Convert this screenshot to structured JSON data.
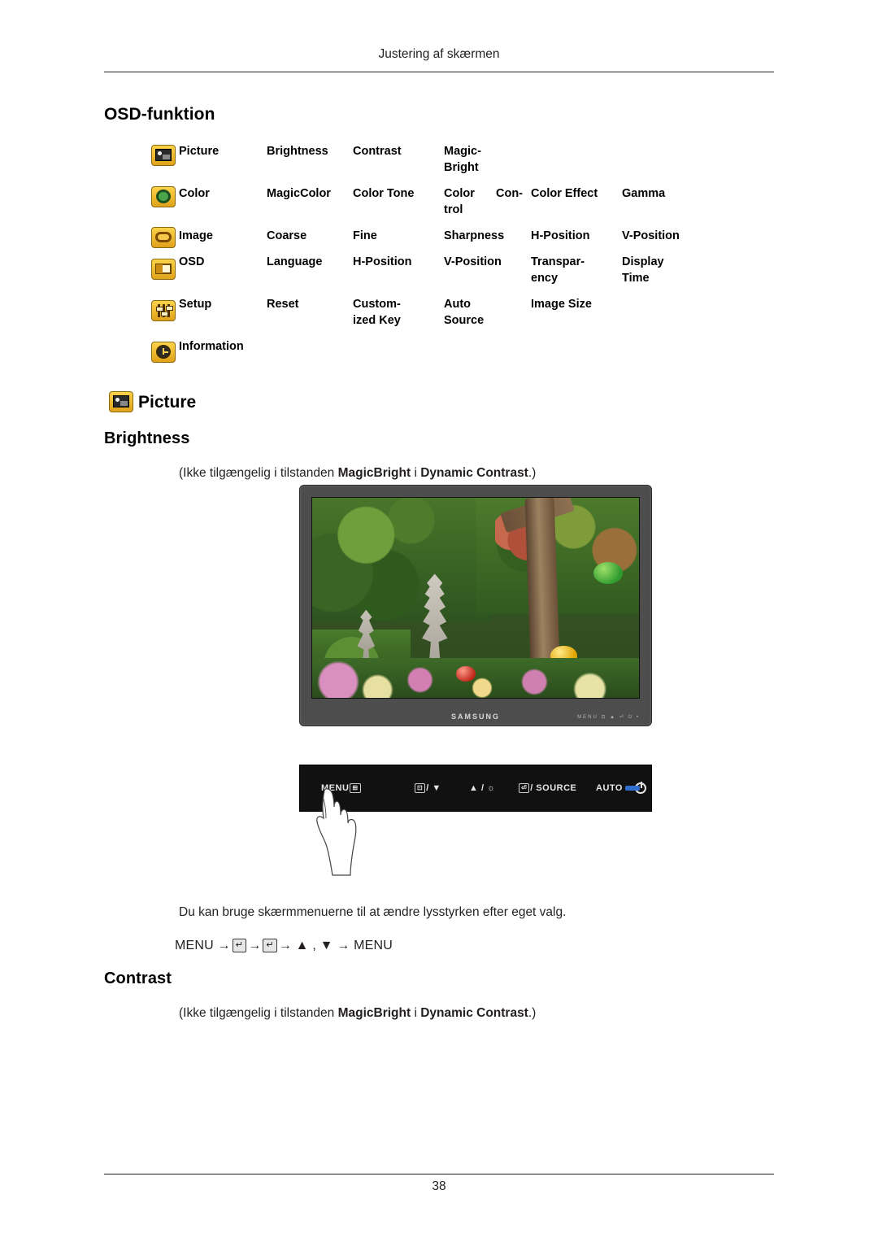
{
  "page": {
    "header": "Justering af skærmen",
    "number": "38"
  },
  "sections": {
    "osd_funktion_title": "OSD-funktion",
    "picture_title": "Picture",
    "brightness_title": "Brightness",
    "contrast_title": "Contrast"
  },
  "osd_table": {
    "rows": [
      {
        "icon": "picture-icon",
        "label": "Picture",
        "items": [
          "Brightness",
          "Contrast",
          "Magic-\nBright"
        ]
      },
      {
        "icon": "color-icon",
        "label": "Color",
        "items": [
          "MagicColor",
          "Color Tone",
          "Color  Con-\ntrol",
          "Color Effect",
          "Gamma"
        ]
      },
      {
        "icon": "image-icon",
        "label": "Image",
        "items": [
          "Coarse",
          "Fine",
          "Sharpness",
          "H-Position",
          "V-Position"
        ]
      },
      {
        "icon": "osd-icon",
        "label": "OSD",
        "items": [
          "Language",
          "H-Position",
          "V-Position",
          "Transpar-\nency",
          "Display\nTime"
        ]
      },
      {
        "icon": "setup-icon",
        "label": "Setup",
        "items": [
          "Reset",
          "Custom-\nized Key",
          "Auto\nSource",
          "Image Size"
        ]
      },
      {
        "icon": "information-icon",
        "label": "Information",
        "items": []
      }
    ],
    "cells": {
      "r0c0": "Picture",
      "r0c1": "Brightness",
      "r0c2": "Contrast",
      "r0c3": "Magic-",
      "r0c3b": "Bright",
      "r1c0": "Color",
      "r1c1": "MagicColor",
      "r1c2": "Color Tone",
      "r1c3": "Color",
      "r1c4": "Con-",
      "r1c3b": "trol",
      "r1c5": "Color Effect",
      "r1c6": "Gamma",
      "r2c0": "Image",
      "r2c1": "Coarse",
      "r2c2": "Fine",
      "r2c3": "Sharpness",
      "r2c5": "H-Position",
      "r2c6": "V-Position",
      "r3c0": "OSD",
      "r3c1": "Language",
      "r3c2": "H-Position",
      "r3c3": "V-Position",
      "r3c5": "Transpar-",
      "r3c5b": "ency",
      "r3c6": "Display",
      "r3c6b": "Time",
      "r4c0": "Setup",
      "r4c1": "Reset",
      "r4c2": "Custom-",
      "r4c2b": "ized Key",
      "r4c3": "Auto",
      "r4c3b": "Source",
      "r4c5": "Image Size",
      "r5c0": "Information"
    }
  },
  "brightness": {
    "note_prefix": "(Ikke tilgængelig i tilstanden ",
    "note_bold1": "MagicBright",
    "note_mid": " i ",
    "note_bold2": "Dynamic Contrast",
    "note_suffix": ".)",
    "description": "Du kan bruge skærmmenuerne til at ændre lysstyrken efter eget valg.",
    "menu_sequence_start": "MENU →",
    "menu_sequence_mid": "→",
    "menu_sequence_arrows": "→  ▲ , ▼ →  MENU",
    "key_glyph": "↵"
  },
  "contrast": {
    "note_prefix": "(Ikke tilgængelig i tilstanden ",
    "note_bold1": "MagicBright",
    "note_mid": " i ",
    "note_bold2": "Dynamic Contrast",
    "note_suffix": ".)"
  },
  "monitor": {
    "brand": "SAMSUNG",
    "bezel_keys": "MENU  ⊡  ▲  ⏎  ⏻  •"
  },
  "control_panel": {
    "menu_label": "MENU",
    "menu_keys": "⊞",
    "down_label": "/ ▼",
    "down_key": "⊡",
    "up_label": "▲ / ☼",
    "source_label": "/ SOURCE",
    "source_key": "⏎",
    "auto_label": "AUTO",
    "power_icon": "power-icon",
    "led_color": "#2f6fd0"
  },
  "colors": {
    "text": "#231f20",
    "icon_gold": "#e8b11c",
    "led": "#2f6fd0"
  }
}
